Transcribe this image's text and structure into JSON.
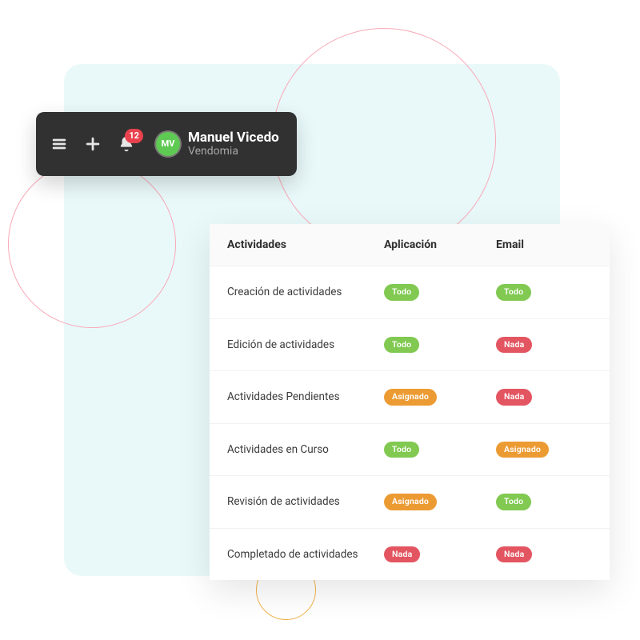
{
  "topbar": {
    "notif_count": "12",
    "avatar_initials": "MV",
    "user_name": "Manuel Vicedo",
    "user_org": "Vendomia"
  },
  "table": {
    "headers": {
      "col_activity": "Actividades",
      "col_app": "Aplicación",
      "col_email": "Email"
    },
    "rows": [
      {
        "activity": "Creación de actividades",
        "app": {
          "label": "Todo",
          "kind": "todo"
        },
        "email": {
          "label": "Todo",
          "kind": "todo"
        }
      },
      {
        "activity": "Edición de actividades",
        "app": {
          "label": "Todo",
          "kind": "todo"
        },
        "email": {
          "label": "Nada",
          "kind": "nada"
        }
      },
      {
        "activity": "Actividades Pendientes",
        "app": {
          "label": "Asignado",
          "kind": "asignado"
        },
        "email": {
          "label": "Nada",
          "kind": "nada"
        }
      },
      {
        "activity": "Actividades en Curso",
        "app": {
          "label": "Todo",
          "kind": "todo"
        },
        "email": {
          "label": "Asignado",
          "kind": "asignado"
        }
      },
      {
        "activity": "Revisión de actividades",
        "app": {
          "label": "Asignado",
          "kind": "asignado"
        },
        "email": {
          "label": "Todo",
          "kind": "todo"
        }
      },
      {
        "activity": "Completado de actividades",
        "app": {
          "label": "Nada",
          "kind": "nada"
        },
        "email": {
          "label": "Nada",
          "kind": "nada"
        }
      }
    ]
  }
}
